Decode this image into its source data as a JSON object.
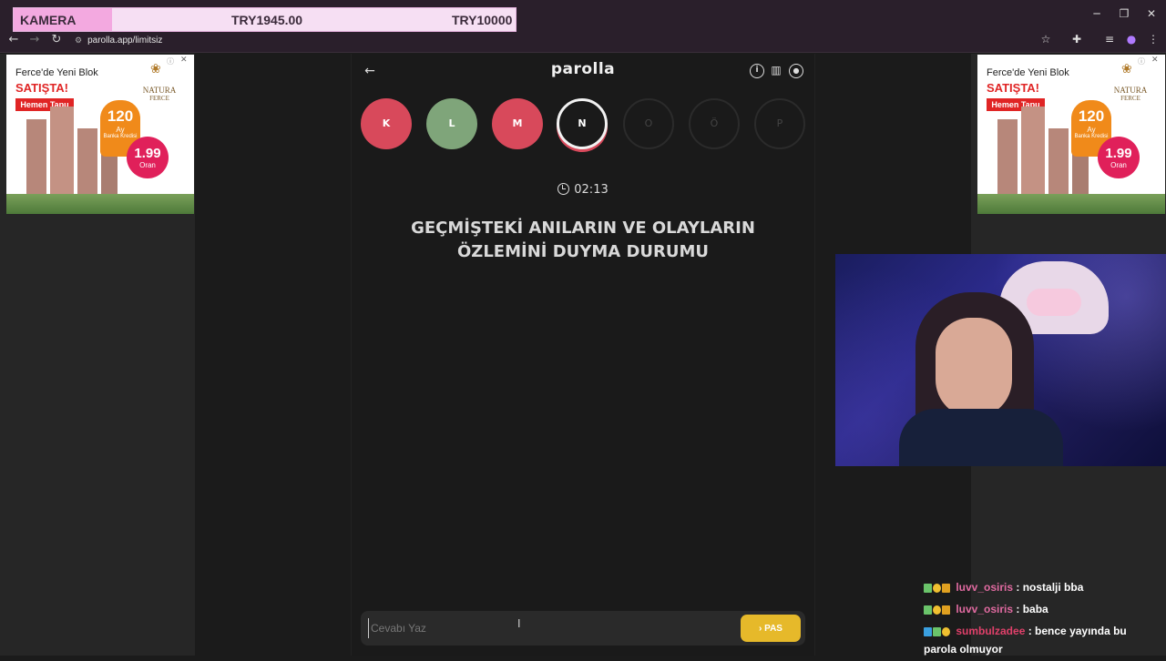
{
  "banner": {
    "label": "KAMERA",
    "current": "TRY1945.00",
    "goal": "TRY10000"
  },
  "browser": {
    "url": "parolla.app/limitsiz"
  },
  "header": {
    "logo": "parolla"
  },
  "letters": [
    {
      "letter": "K",
      "state": "wrong"
    },
    {
      "letter": "L",
      "state": "correct"
    },
    {
      "letter": "M",
      "state": "wrong"
    },
    {
      "letter": "N",
      "state": "active"
    },
    {
      "letter": "O",
      "state": "pending"
    },
    {
      "letter": "Ö",
      "state": "pending"
    },
    {
      "letter": "P",
      "state": "pending"
    }
  ],
  "timer": "02:13",
  "question": "GEÇMİŞTEKİ ANILARIN VE OLAYLARIN ÖZLEMİNİ DUYMA DURUMU",
  "answer": {
    "placeholder": "Cevabı Yaz",
    "value": ""
  },
  "pass_button": {
    "label": "PAS",
    "icon": "chevron-right-icon"
  },
  "ad": {
    "line1": "Ferce'de Yeni Blok",
    "line2": "SATIŞTA!",
    "cta": "Hemen Tapu",
    "brand": "NATURA",
    "brand_sub": "FERCE",
    "months": "120",
    "months_unit": "Ay",
    "months_sub": "Banka Kredisi",
    "rate": "1.99",
    "rate_unit": "Oran"
  },
  "chat": [
    {
      "user": "luvv_osiris",
      "text": ": nostalji bba"
    },
    {
      "user": "luvv_osiris",
      "text": ": baba"
    },
    {
      "user": "sumbulzadee",
      "text": ": bence yayında bu parola olmuyor"
    }
  ],
  "colors": {
    "wrong": "#d8495b",
    "correct": "#7fa57a",
    "accent": "#e6b92a"
  }
}
